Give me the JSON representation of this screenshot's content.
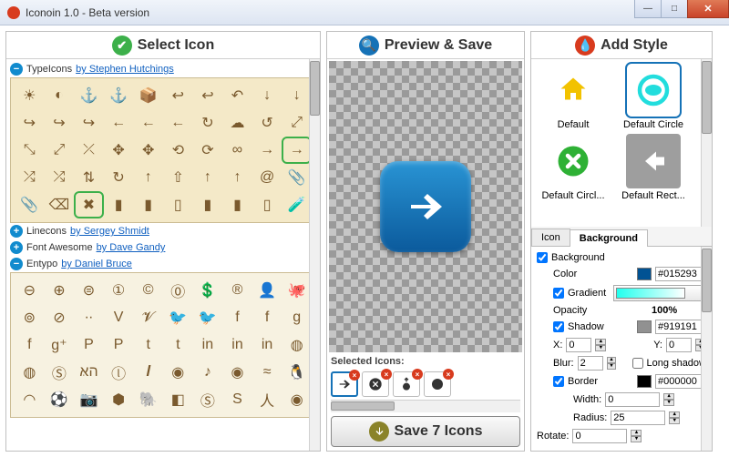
{
  "window": {
    "title": "Iconoin 1.0 - Beta version"
  },
  "headers": {
    "select": "Select Icon",
    "preview": "Preview & Save",
    "style": "Add Style"
  },
  "sets": {
    "typeicons": {
      "name": "TypeIcons",
      "by": "by Stephen Hutchings"
    },
    "linecons": {
      "name": "Linecons",
      "by": "by Sergey Shmidt"
    },
    "fontawesome": {
      "name": "Font Awesome",
      "by": "by Dave Gandy"
    },
    "entypo": {
      "name": "Entypo",
      "by": "by Daniel Bruce"
    }
  },
  "selected_label": "Selected Icons:",
  "save_label": "Save 7 Icons",
  "styles": {
    "items": [
      {
        "label": "Default"
      },
      {
        "label": "Default Circle"
      },
      {
        "label": "Default Circl..."
      },
      {
        "label": "Default Rect..."
      }
    ]
  },
  "tabs": {
    "icon": "Icon",
    "background": "Background"
  },
  "bg": {
    "background_label": "Background",
    "color_label": "Color",
    "color_value": "#015293",
    "gradient_label": "Gradient",
    "opacity_label": "Opacity",
    "opacity_value": "100%",
    "shadow_label": "Shadow",
    "shadow_value": "#919191",
    "x_label": "X:",
    "x_value": "0",
    "y_label": "Y:",
    "y_value": "0",
    "blur_label": "Blur:",
    "blur_value": "2",
    "long_shadow_label": "Long shadow",
    "border_label": "Border",
    "border_color": "#000000",
    "width_label": "Width:",
    "width_value": "0",
    "radius_label": "Radius:",
    "radius_value": "25",
    "rotate_label": "Rotate:",
    "rotate_value": "0"
  },
  "colors": {
    "accent": "#1572b7",
    "brand": "#d83b1e",
    "ok": "#3cb04a"
  }
}
